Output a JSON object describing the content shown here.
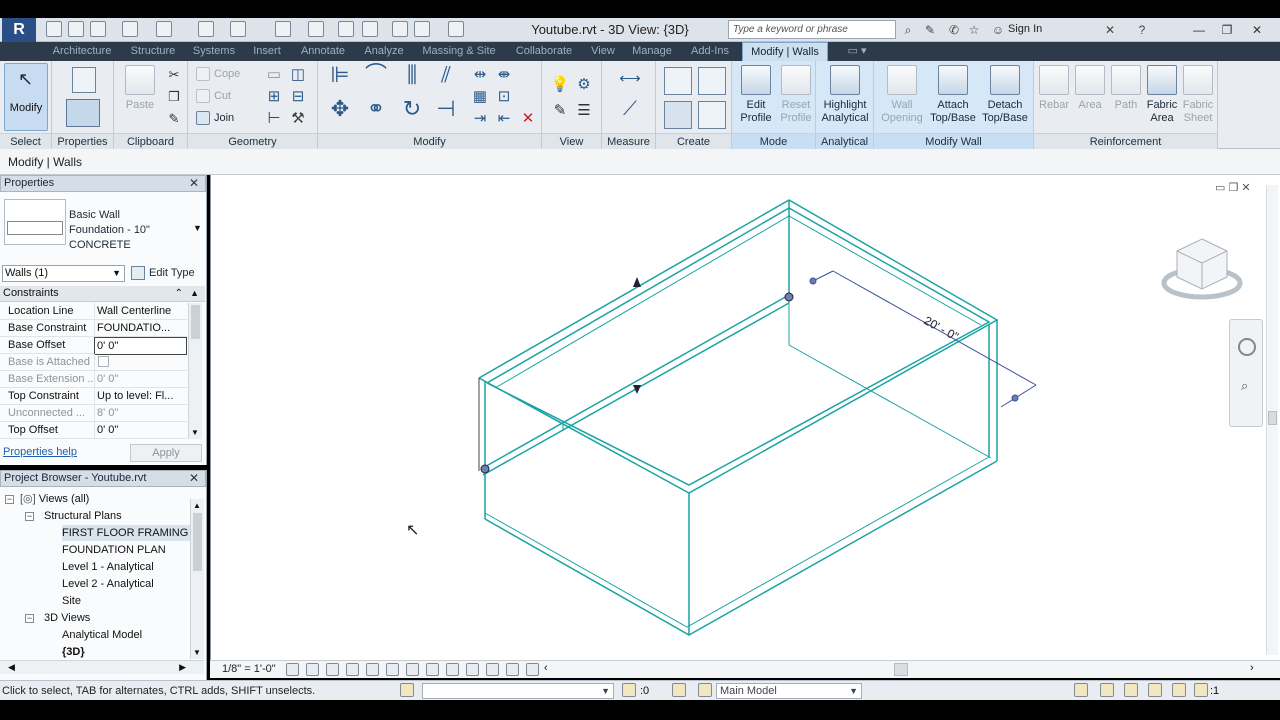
{
  "title_bar": {
    "document_title": "Youtube.rvt - 3D View: {3D}",
    "search_placeholder": "Type a keyword or phrase",
    "sign_in_label": "Sign In",
    "app_logo": "R"
  },
  "ribbon_tabs": [
    "Architecture",
    "Structure",
    "Systems",
    "Insert",
    "Annotate",
    "Analyze",
    "Massing & Site",
    "Collaborate",
    "View",
    "Manage",
    "Add-Ins",
    "Modify | Walls"
  ],
  "ribbon": {
    "select_panel": {
      "title": "Select",
      "modify_label": "Modify"
    },
    "properties_panel": {
      "title": "Properties"
    },
    "clipboard_panel": {
      "title": "Clipboard",
      "paste_label": "Paste"
    },
    "geometry_panel": {
      "title": "Geometry",
      "cope_label": "Cope",
      "cut_label": "Cut",
      "join_label": "Join"
    },
    "modify_panel": {
      "title": "Modify"
    },
    "view_panel": {
      "title": "View"
    },
    "measure_panel": {
      "title": "Measure"
    },
    "create_panel": {
      "title": "Create"
    },
    "mode_panel": {
      "title": "Mode",
      "edit_profile_label": "Edit Profile",
      "reset_profile_label": "Reset Profile"
    },
    "analytical_panel": {
      "title": "Analytical",
      "highlight_label": "Highlight Analytical"
    },
    "modify_wall_panel": {
      "title": "Modify Wall",
      "wall_opening_label": "Wall Opening",
      "attach_label": "Attach Top/Base",
      "detach_label": "Detach Top/Base"
    },
    "reinforcement_panel": {
      "title": "Reinforcement",
      "rebar_label": "Rebar",
      "area_label": "Area",
      "path_label": "Path",
      "fabric_area_label": "Fabric Area",
      "fabric_sheet_label": "Fabric Sheet"
    }
  },
  "options_bar": {
    "label": "Modify | Walls"
  },
  "properties": {
    "header": "Properties",
    "type_family": "Basic Wall",
    "type_name": "Foundation - 10\"",
    "type_material": "CONCRETE",
    "instance_filter": "Walls (1)",
    "edit_type_label": "Edit Type",
    "group_header": "Constraints",
    "rows": [
      {
        "name": "Location Line",
        "value": "Wall Centerline",
        "dim": false
      },
      {
        "name": "Base Constraint",
        "value": "FOUNDATIO...",
        "dim": false
      },
      {
        "name": "Base Offset",
        "value": "0'  0\"",
        "dim": false
      },
      {
        "name": "Base is Attached",
        "value": "",
        "dim": true
      },
      {
        "name": "Base Extension ...",
        "value": "0'  0\"",
        "dim": true
      },
      {
        "name": "Top Constraint",
        "value": "Up to level: Fl...",
        "dim": false
      },
      {
        "name": "Unconnected ...",
        "value": "8'  0\"",
        "dim": true
      },
      {
        "name": "Top Offset",
        "value": "0'  0\"",
        "dim": false
      }
    ],
    "help_link": "Properties help",
    "apply_label": "Apply"
  },
  "project_browser": {
    "header": "Project Browser - Youtube.rvt",
    "items": [
      "Views (all)",
      "Structural Plans",
      "FIRST FLOOR FRAMING P",
      "FOUNDATION PLAN",
      "Level 1 - Analytical",
      "Level 2 - Analytical",
      "Site",
      "3D Views",
      "Analytical Model",
      "{3D}"
    ]
  },
  "view": {
    "dimension_label": "20' - 0\"",
    "scale": "1/8\" = 1'-0\""
  },
  "status_bar": {
    "message": "Click to select, TAB for alternates, CTRL adds, SHIFT unselects.",
    "selection_count": ":0",
    "model_dropdown": "Main Model",
    "filter_count": ":1"
  },
  "colors": {
    "wall_selected": "#1aa3a3",
    "dimension": "#3a4f9a",
    "ribbon_tab_bg": "#2c3a4a",
    "context_tab": "#cde0f0"
  }
}
